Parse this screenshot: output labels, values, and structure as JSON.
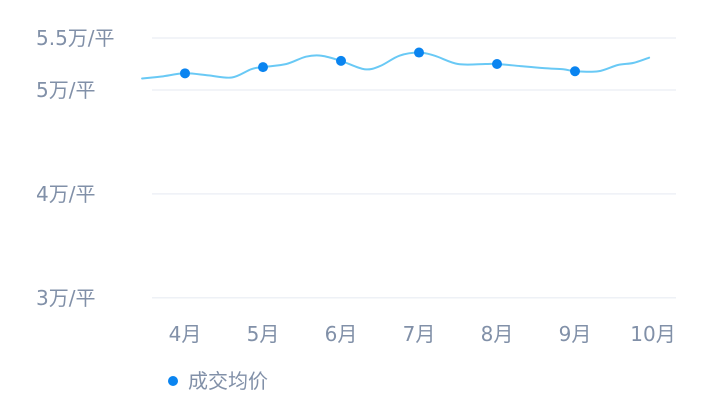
{
  "chart_data": {
    "type": "line",
    "smooth": true,
    "categories": [
      "4月",
      "5月",
      "6月",
      "7月",
      "8月",
      "9月",
      "10月"
    ],
    "y_ticks": [
      {
        "value": 3,
        "label": "3万/平"
      },
      {
        "value": 4,
        "label": "4万/平"
      },
      {
        "value": 5,
        "label": "5万/平"
      },
      {
        "value": 5.5,
        "label": "5.5万/平"
      }
    ],
    "ylim": [
      2.95,
      5.5
    ],
    "grid": true,
    "legend_position": "bottom-left",
    "series": [
      {
        "name": "成交均价",
        "line_color": "#69c9f5",
        "marker_color": "#0a84f0",
        "values": [
          5.16,
          5.22,
          5.28,
          5.36,
          5.25,
          5.18,
          null
        ],
        "trend": [
          [
            -0.55,
            5.11
          ],
          [
            -0.3,
            5.13
          ],
          [
            0.0,
            5.16
          ],
          [
            0.3,
            5.14
          ],
          [
            0.6,
            5.12
          ],
          [
            0.85,
            5.2
          ],
          [
            1.0,
            5.22
          ],
          [
            1.3,
            5.25
          ],
          [
            1.55,
            5.32
          ],
          [
            1.75,
            5.33
          ],
          [
            2.0,
            5.28
          ],
          [
            2.3,
            5.2
          ],
          [
            2.5,
            5.23
          ],
          [
            2.75,
            5.33
          ],
          [
            3.0,
            5.36
          ],
          [
            3.2,
            5.33
          ],
          [
            3.5,
            5.25
          ],
          [
            3.85,
            5.25
          ],
          [
            4.0,
            5.25
          ],
          [
            4.3,
            5.23
          ],
          [
            4.6,
            5.21
          ],
          [
            4.85,
            5.2
          ],
          [
            5.0,
            5.18
          ],
          [
            5.3,
            5.18
          ],
          [
            5.55,
            5.24
          ],
          [
            5.75,
            5.26
          ],
          [
            5.95,
            5.31
          ]
        ]
      }
    ]
  }
}
